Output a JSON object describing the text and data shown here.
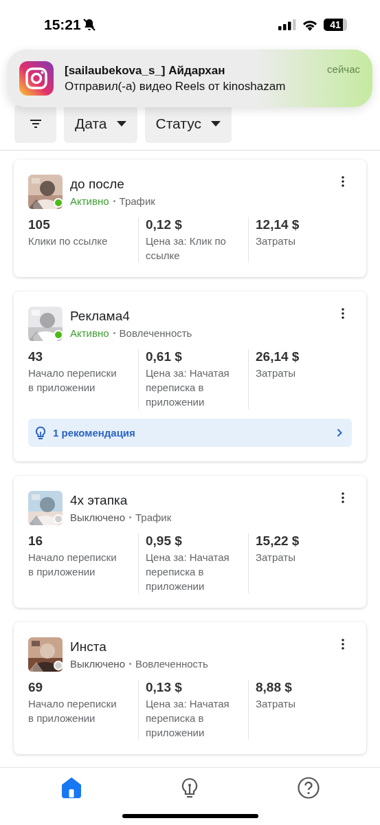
{
  "status_bar": {
    "time": "15:21",
    "battery": "41"
  },
  "notification": {
    "sender": "[sailaubekova_s_] Айдархан",
    "message": "Отправил(-а) видео Reels от kinoshazam",
    "time": "сейчас"
  },
  "filters": [
    {
      "kind": "icon"
    },
    {
      "kind": "dropdown",
      "label": "Дата"
    },
    {
      "kind": "dropdown",
      "label": "Статус"
    }
  ],
  "campaigns": [
    {
      "name": "до после",
      "active": true,
      "status": "Активно",
      "objective": "Трафик",
      "metrics": [
        {
          "value": "105",
          "label": "Клики по ссылке"
        },
        {
          "value": "0,12 $",
          "label": "Цена за: Клик по ссылке"
        },
        {
          "value": "12,14 $",
          "label": "Затраты"
        }
      ]
    },
    {
      "name": "Реклама4",
      "active": true,
      "status": "Активно",
      "objective": "Вовлеченность",
      "metrics": [
        {
          "value": "43",
          "label": "Начало переписки в приложении"
        },
        {
          "value": "0,61 $",
          "label": "Цена за: Начатая переписка в приложении"
        },
        {
          "value": "26,14 $",
          "label": "Затраты"
        }
      ],
      "recommendation": "1 рекомендация"
    },
    {
      "name": "4х этапка",
      "active": false,
      "status": "Выключено",
      "objective": "Трафик",
      "metrics": [
        {
          "value": "16",
          "label": "Начало переписки в приложении"
        },
        {
          "value": "0,95 $",
          "label": "Цена за: Начатая переписка в приложении"
        },
        {
          "value": "15,22 $",
          "label": "Затраты"
        }
      ]
    },
    {
      "name": "Инста",
      "active": false,
      "status": "Выключено",
      "objective": "Вовлеченность",
      "metrics": [
        {
          "value": "69",
          "label": "Начало переписки в приложении"
        },
        {
          "value": "0,13 $",
          "label": "Цена за: Начатая переписка в приложении"
        },
        {
          "value": "8,88 $",
          "label": "Затраты"
        }
      ]
    }
  ],
  "bottom_nav": [
    {
      "kind": "home",
      "selected": true
    },
    {
      "kind": "bulb",
      "selected": false
    },
    {
      "kind": "help",
      "selected": false
    }
  ]
}
